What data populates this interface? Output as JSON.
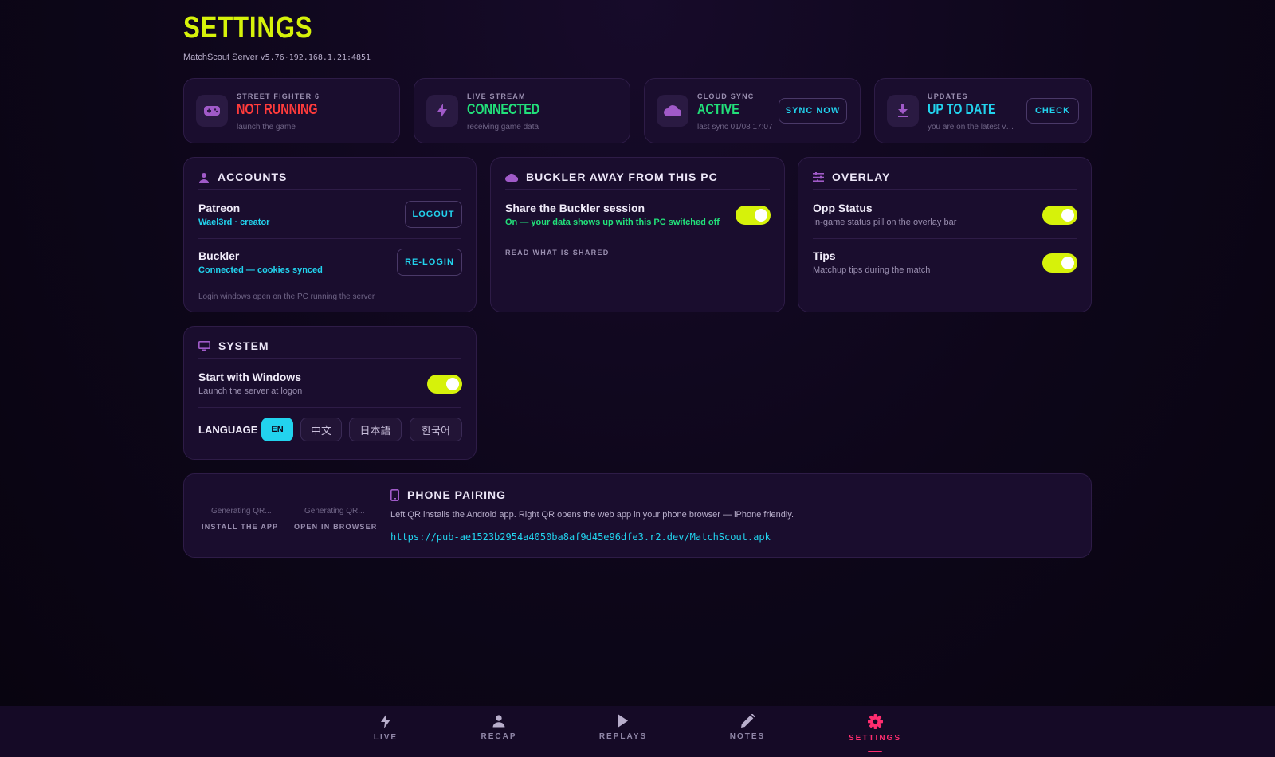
{
  "header": {
    "title": "SETTINGS",
    "server_name": "MatchScout Server",
    "server_info": "v5.76·192.168.1.21:4851"
  },
  "status_cards": [
    {
      "label": "STREET FIGHTER 6",
      "value": "NOT RUNNING",
      "sub": "launch the game",
      "icon": "gamepad-icon",
      "color": "#ff3b3b"
    },
    {
      "label": "LIVE STREAM",
      "value": "CONNECTED",
      "sub": "receiving game data",
      "icon": "bolt-icon",
      "color": "#22e07a"
    },
    {
      "label": "CLOUD SYNC",
      "value": "ACTIVE",
      "sub": "last sync 01/08 17:07",
      "icon": "cloud-icon",
      "color": "#22e07a",
      "button": "SYNC NOW"
    },
    {
      "label": "UPDATES",
      "value": "UP TO DATE",
      "sub": "you are on the latest version",
      "icon": "download-icon",
      "color": "#22d3ee",
      "button": "CHECK"
    }
  ],
  "accounts": {
    "title": "ACCOUNTS",
    "patreon_title": "Patreon",
    "patreon_sub": "Wael3rd · creator",
    "patreon_button": "LOGOUT",
    "buckler_title": "Buckler",
    "buckler_sub": "Connected — cookies synced",
    "buckler_button": "RE-LOGIN",
    "note": "Login windows open on the PC running the server"
  },
  "buckler_away": {
    "title": "BUCKLER AWAY FROM THIS PC",
    "share_title": "Share the Buckler session",
    "share_sub": "On — your data shows up with this PC switched off",
    "share_on": true,
    "read_link": "READ WHAT IS SHARED"
  },
  "overlay": {
    "title": "OVERLAY",
    "opp_title": "Opp Status",
    "opp_sub": "In-game status pill on the overlay bar",
    "opp_on": true,
    "tips_title": "Tips",
    "tips_sub": "Matchup tips during the match",
    "tips_on": true
  },
  "system": {
    "title": "SYSTEM",
    "start_title": "Start with Windows",
    "start_sub": "Launch the server at logon",
    "start_on": true,
    "language_label": "LANGUAGE",
    "languages": [
      "EN",
      "中文",
      "日本語",
      "한국어"
    ],
    "selected_language": "EN"
  },
  "phone_pairing": {
    "title": "PHONE PAIRING",
    "qr1_status": "Generating QR...",
    "qr1_label": "INSTALL THE APP",
    "qr2_status": "Generating QR...",
    "qr2_label": "OPEN IN BROWSER",
    "description": "Left QR installs the Android app. Right QR opens the web app in your phone browser — iPhone friendly.",
    "url": "https://pub-ae1523b2954a4050ba8af9d45e96dfe3.r2.dev/MatchScout.apk"
  },
  "nav": {
    "items": [
      {
        "label": "LIVE",
        "icon": "bolt-icon"
      },
      {
        "label": "RECAP",
        "icon": "person-icon"
      },
      {
        "label": "REPLAYS",
        "icon": "play-icon"
      },
      {
        "label": "NOTES",
        "icon": "pencil-icon"
      },
      {
        "label": "SETTINGS",
        "icon": "gear-icon"
      }
    ],
    "active": "SETTINGS"
  },
  "colors": {
    "accent_lime": "#d6f20a",
    "accent_cyan": "#22d3ee",
    "accent_green": "#22e07a",
    "accent_red": "#ff3b3b",
    "accent_pink": "#ff2d6f",
    "icon_purple": "#a05ac8"
  }
}
